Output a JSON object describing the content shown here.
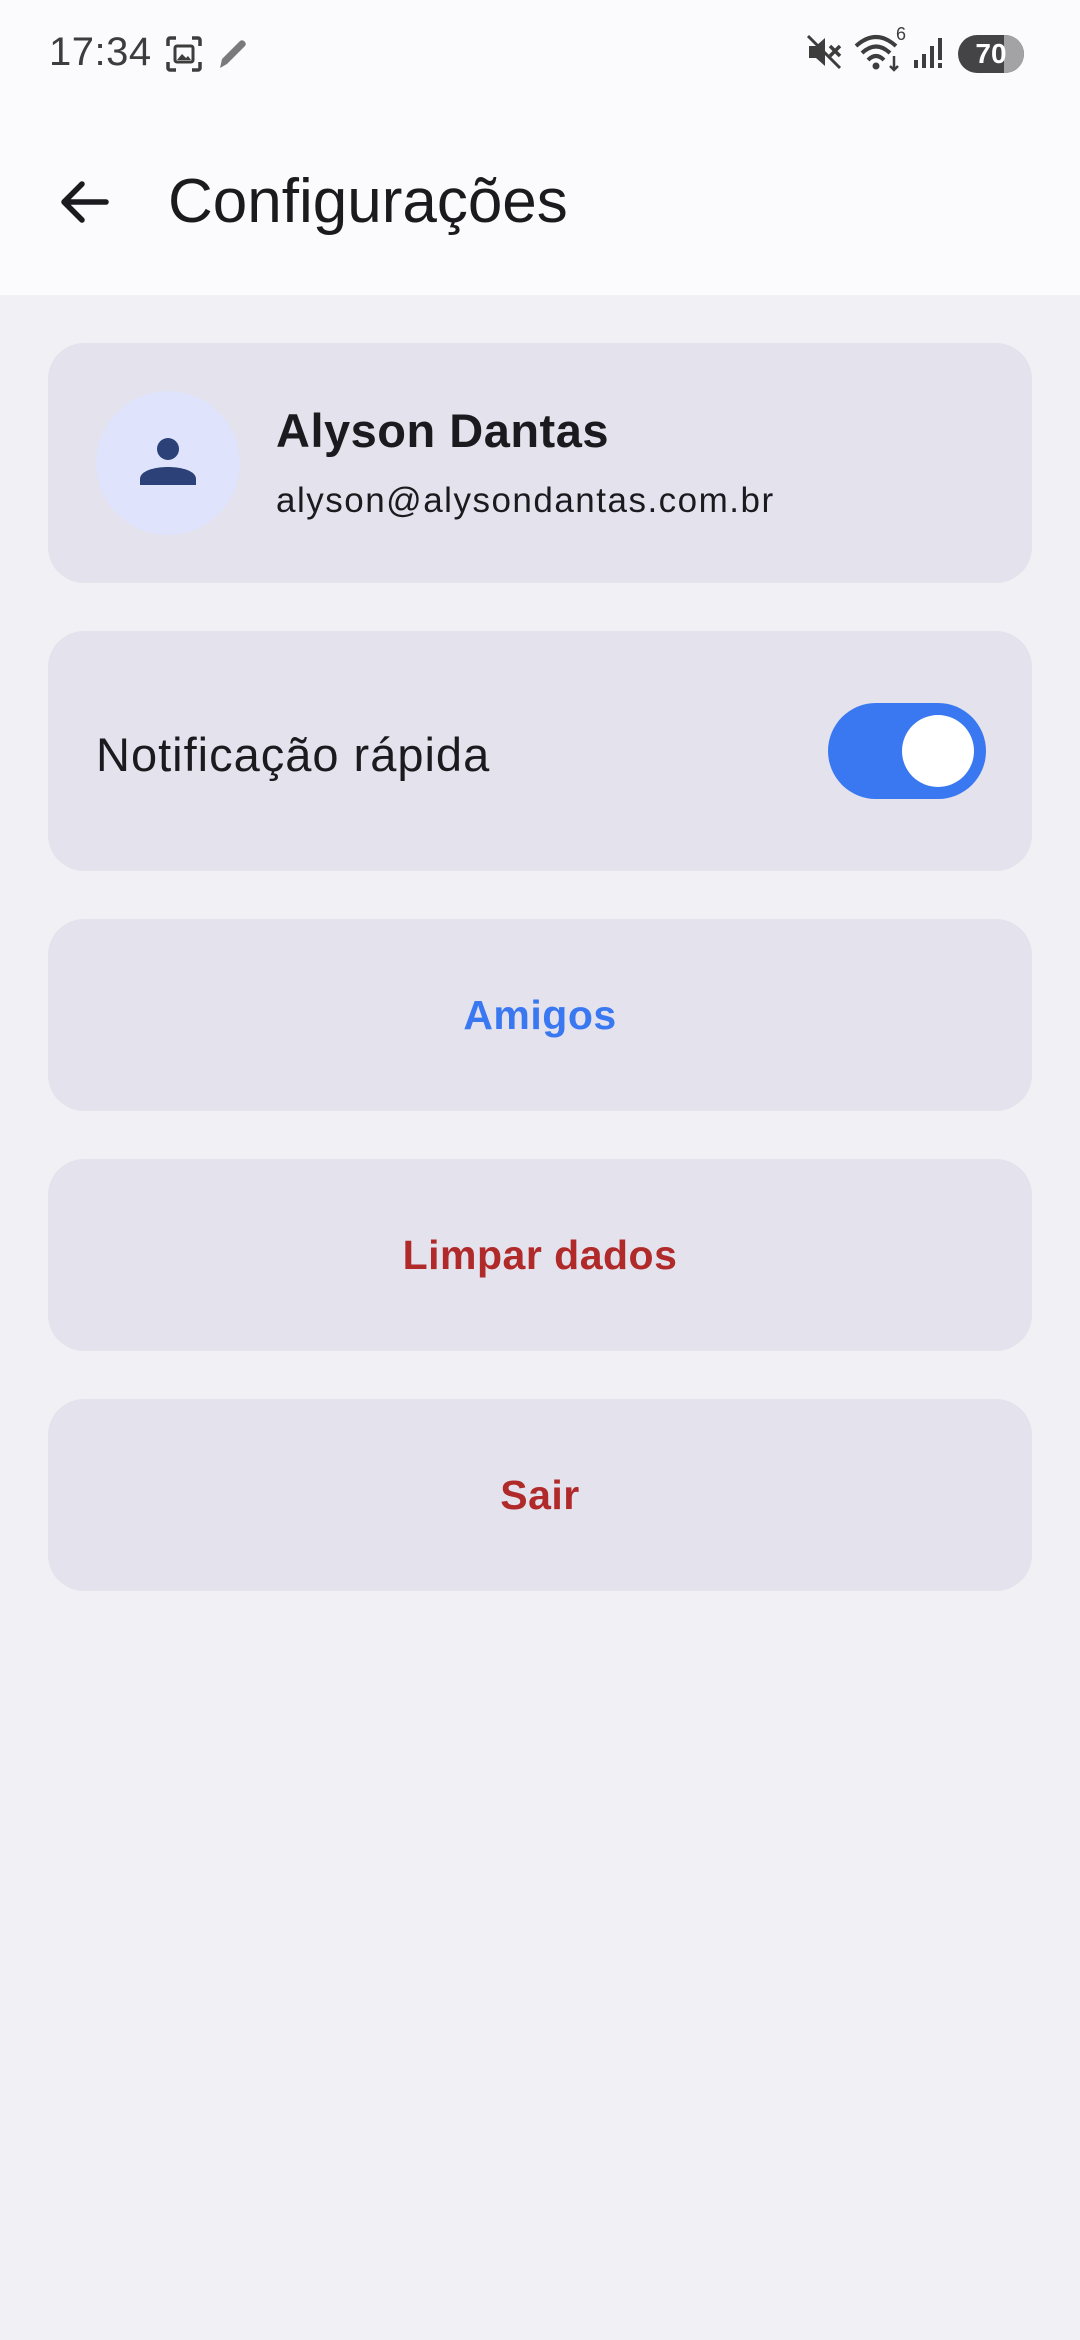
{
  "status_bar": {
    "time": "17:34",
    "battery": "70",
    "icons": [
      "screenshot-icon",
      "pen-icon",
      "mute-icon",
      "wifi-icon",
      "signal-icon",
      "battery-icon"
    ],
    "wifi_badge": "6"
  },
  "app_bar": {
    "title": "Configurações",
    "back_icon": "arrow-back-icon"
  },
  "profile": {
    "name": "Alyson Dantas",
    "email": "alyson@alysondantas.com.br",
    "avatar_icon": "person-icon"
  },
  "notification": {
    "label": "Notificação rápida",
    "enabled": true
  },
  "actions": {
    "friends": "Amigos",
    "clear_data": "Limpar dados",
    "logout": "Sair"
  },
  "colors": {
    "accent": "#3a78f2",
    "danger": "#b02a2a",
    "card_bg": "#e3e2ed",
    "page_bg": "#f1f0f4",
    "avatar_bg": "#dfe3fb",
    "avatar_icon": "#2b4178"
  }
}
